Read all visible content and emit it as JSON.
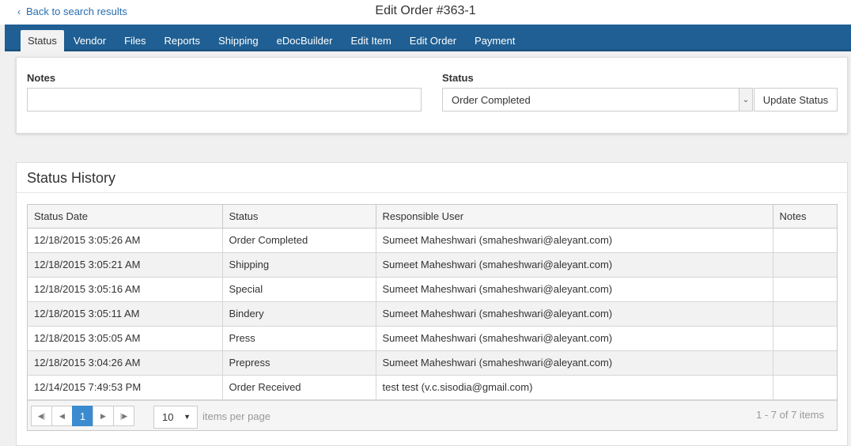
{
  "header": {
    "back_label": "Back to search results",
    "title": "Edit Order #363-1"
  },
  "tabs": [
    {
      "label": "Status",
      "active": true
    },
    {
      "label": "Vendor"
    },
    {
      "label": "Files"
    },
    {
      "label": "Reports"
    },
    {
      "label": "Shipping"
    },
    {
      "label": "eDocBuilder"
    },
    {
      "label": "Edit Item"
    },
    {
      "label": "Edit Order"
    },
    {
      "label": "Payment"
    }
  ],
  "form": {
    "notes_label": "Notes",
    "notes_value": "",
    "status_label": "Status",
    "status_selected": "Order Completed",
    "update_button": "Update Status"
  },
  "history": {
    "title": "Status History",
    "columns": [
      "Status Date",
      "Status",
      "Responsible User",
      "Notes"
    ],
    "rows": [
      {
        "date": "12/18/2015 3:05:26 AM",
        "status": "Order Completed",
        "user": "Sumeet Maheshwari (smaheshwari@aleyant.com)",
        "notes": ""
      },
      {
        "date": "12/18/2015 3:05:21 AM",
        "status": "Shipping",
        "user": "Sumeet Maheshwari (smaheshwari@aleyant.com)",
        "notes": ""
      },
      {
        "date": "12/18/2015 3:05:16 AM",
        "status": "Special",
        "user": "Sumeet Maheshwari (smaheshwari@aleyant.com)",
        "notes": ""
      },
      {
        "date": "12/18/2015 3:05:11 AM",
        "status": "Bindery",
        "user": "Sumeet Maheshwari (smaheshwari@aleyant.com)",
        "notes": ""
      },
      {
        "date": "12/18/2015 3:05:05 AM",
        "status": "Press",
        "user": "Sumeet Maheshwari (smaheshwari@aleyant.com)",
        "notes": ""
      },
      {
        "date": "12/18/2015 3:04:26 AM",
        "status": "Prepress",
        "user": "Sumeet Maheshwari (smaheshwari@aleyant.com)",
        "notes": ""
      },
      {
        "date": "12/14/2015 7:49:53 PM",
        "status": "Order Received",
        "user": "test test (v.c.sisodia@gmail.com)",
        "notes": ""
      }
    ],
    "pager": {
      "current_page": "1",
      "page_size": "10",
      "per_page_label": "items per page",
      "count_label": "1 - 7 of 7 items"
    }
  },
  "colors": {
    "nav_bg": "#1f5f93",
    "link": "#2a6db0",
    "pager_active": "#3a8bcf"
  }
}
